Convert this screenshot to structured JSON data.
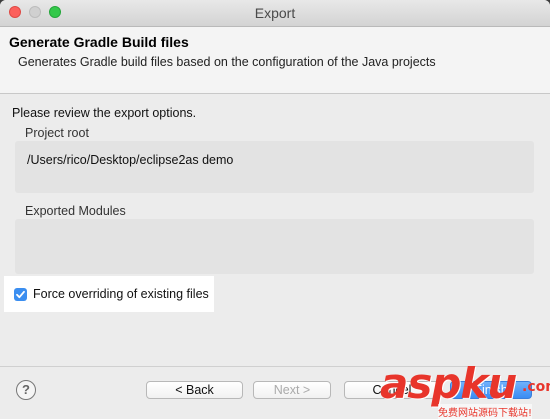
{
  "window": {
    "title": "Export"
  },
  "header": {
    "title": "Generate Gradle Build files",
    "description": "Generates Gradle build files based on the configuration of the Java projects"
  },
  "content": {
    "review_text": "Please review the export options.",
    "project_root": {
      "label": "Project root",
      "value": "/Users/rico/Desktop/eclipse2as demo"
    },
    "exported_modules": {
      "label": "Exported Modules",
      "value": ""
    },
    "force_override": {
      "label": "Force overriding of existing files",
      "checked": true
    }
  },
  "buttons": {
    "help": "?",
    "back": "< Back",
    "next": "Next >",
    "cancel": "Cancel",
    "finish": "Finish"
  },
  "watermark": {
    "brand": "aspku",
    "dotcom": ".com",
    "subtitle": "免费网站源码下载站!"
  },
  "colors": {
    "checkbox": "#3b8ef0",
    "watermark": "#e8352b"
  }
}
